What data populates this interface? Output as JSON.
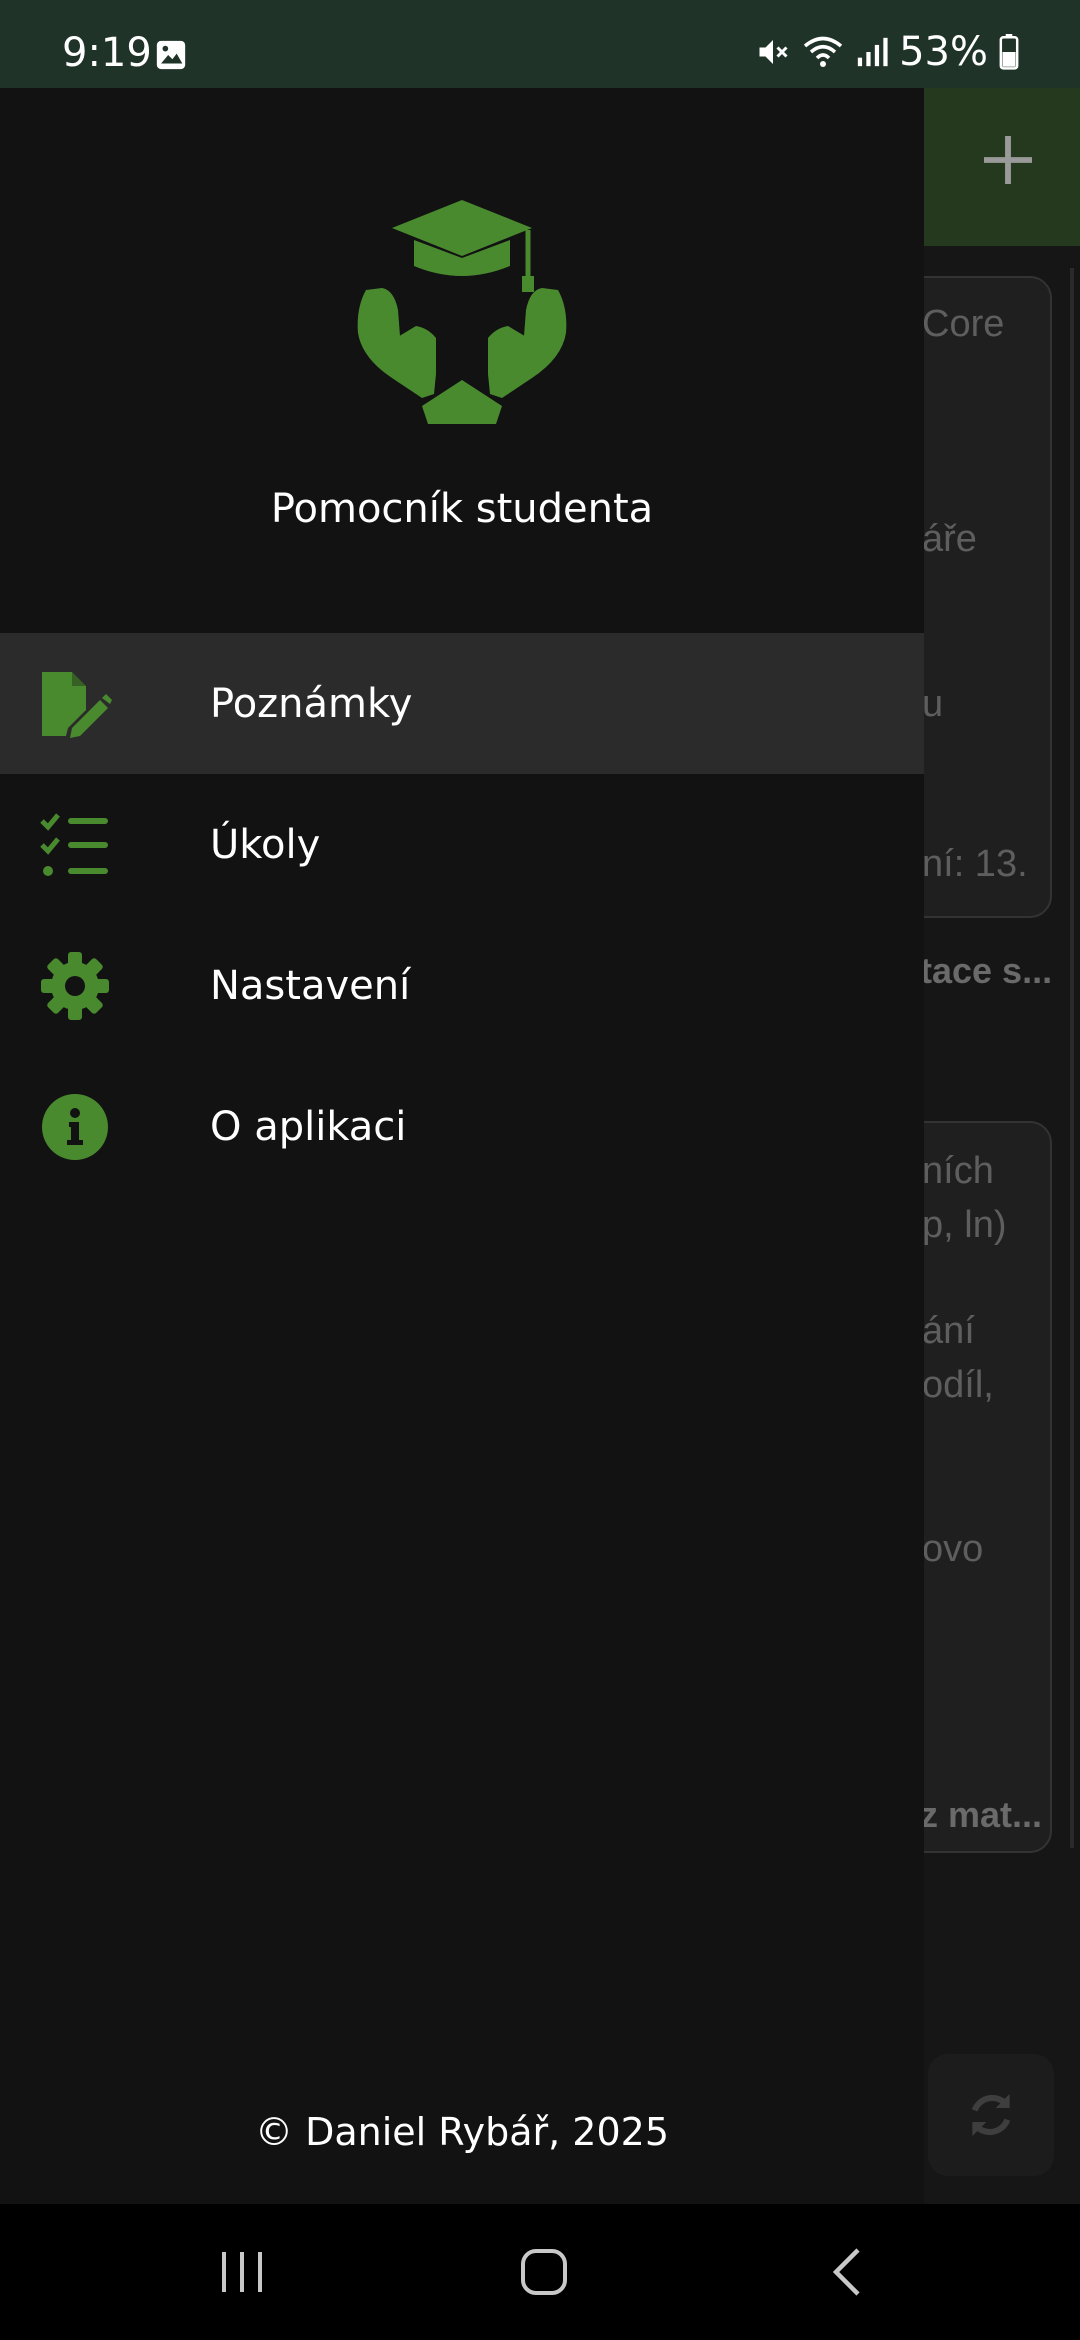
{
  "status_bar": {
    "time": "9:19",
    "battery": "53%",
    "icons": [
      "gallery-icon",
      "mute-icon",
      "wifi-icon",
      "signal-icon",
      "battery-icon"
    ]
  },
  "background_app": {
    "card1_fragments": [
      "Core",
      "áře",
      "u",
      "ní: 13."
    ],
    "card1_title": "tace s...",
    "card2_fragments": [
      "ních",
      "p, ln)",
      "ání",
      "odíl,",
      "ovo"
    ],
    "card2_title": "z mat..."
  },
  "drawer": {
    "app_name": "Pomocník studenta",
    "items": [
      {
        "label": "Poznámky",
        "icon": "note-edit-icon",
        "active": true
      },
      {
        "label": "Úkoly",
        "icon": "checklist-icon",
        "active": false
      },
      {
        "label": "Nastavení",
        "icon": "gear-icon",
        "active": false
      },
      {
        "label": "O aplikaci",
        "icon": "info-icon",
        "active": false
      }
    ],
    "copyright": "© Daniel Rybář, 2025"
  },
  "colors": {
    "accent": "#4a8a2f",
    "drawer_bg": "#121212",
    "active_item_bg": "#2b2b2b",
    "status_bar_bg": "#1f3328",
    "app_bar_bg": "#24391e"
  }
}
